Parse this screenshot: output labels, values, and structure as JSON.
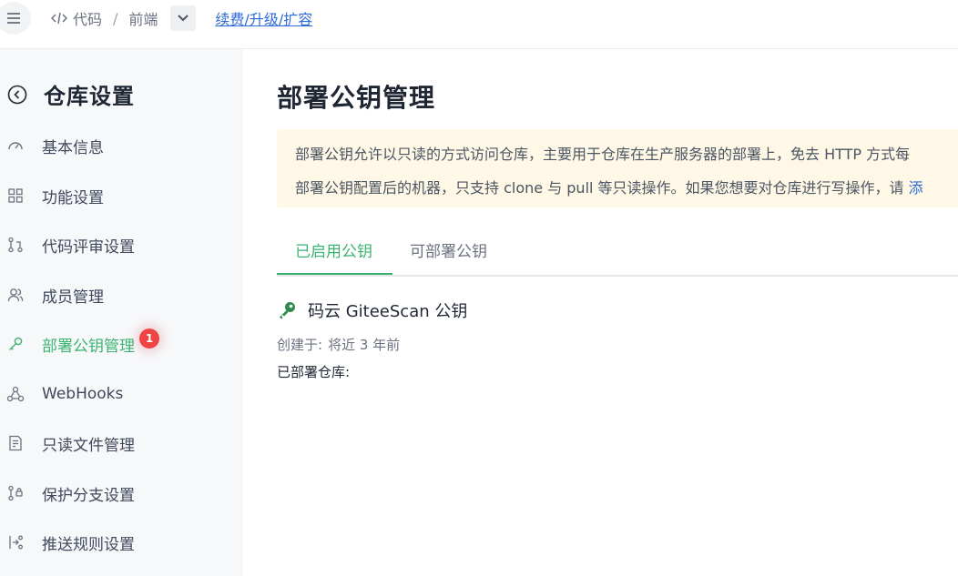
{
  "topbar": {
    "breadcrumb": [
      "代码",
      "前端"
    ],
    "breadcrumb_sep": "/",
    "renew_link": "续费/升级/扩容"
  },
  "sidebar": {
    "title": "仓库设置",
    "items": [
      {
        "label": "基本信息",
        "icon": "gauge-icon"
      },
      {
        "label": "功能设置",
        "icon": "grid-icon"
      },
      {
        "label": "代码评审设置",
        "icon": "pull-request-icon"
      },
      {
        "label": "成员管理",
        "icon": "users-icon"
      },
      {
        "label": "部署公钥管理",
        "icon": "key-icon",
        "active": true,
        "badge": "1"
      },
      {
        "label": "WebHooks",
        "icon": "webhook-icon"
      },
      {
        "label": "只读文件管理",
        "icon": "file-lock-icon"
      },
      {
        "label": "保护分支设置",
        "icon": "branch-lock-icon"
      },
      {
        "label": "推送规则设置",
        "icon": "push-rule-icon"
      }
    ]
  },
  "main": {
    "title": "部署公钥管理",
    "notice_line1": "部署公钥允许以只读的方式访问仓库，主要用于仓库在生产服务器的部署上，免去 HTTP 方式每",
    "notice_line2": "部署公钥配置后的机器，只支持 clone 与 pull 等只读操作。如果您想要对仓库进行写操作，请",
    "notice_link": "添",
    "tabs": [
      "已启用公钥",
      "可部署公钥"
    ],
    "key": {
      "name": "码云 GiteeScan 公钥",
      "created_label": "创建于:",
      "created_value": "将近 3 年前",
      "deployed_label": "已部署仓库:"
    }
  },
  "colors": {
    "accent": "#3cb371",
    "badge": "#ef4444",
    "link": "#2f6bd8",
    "notice_bg": "#fff8e6"
  }
}
